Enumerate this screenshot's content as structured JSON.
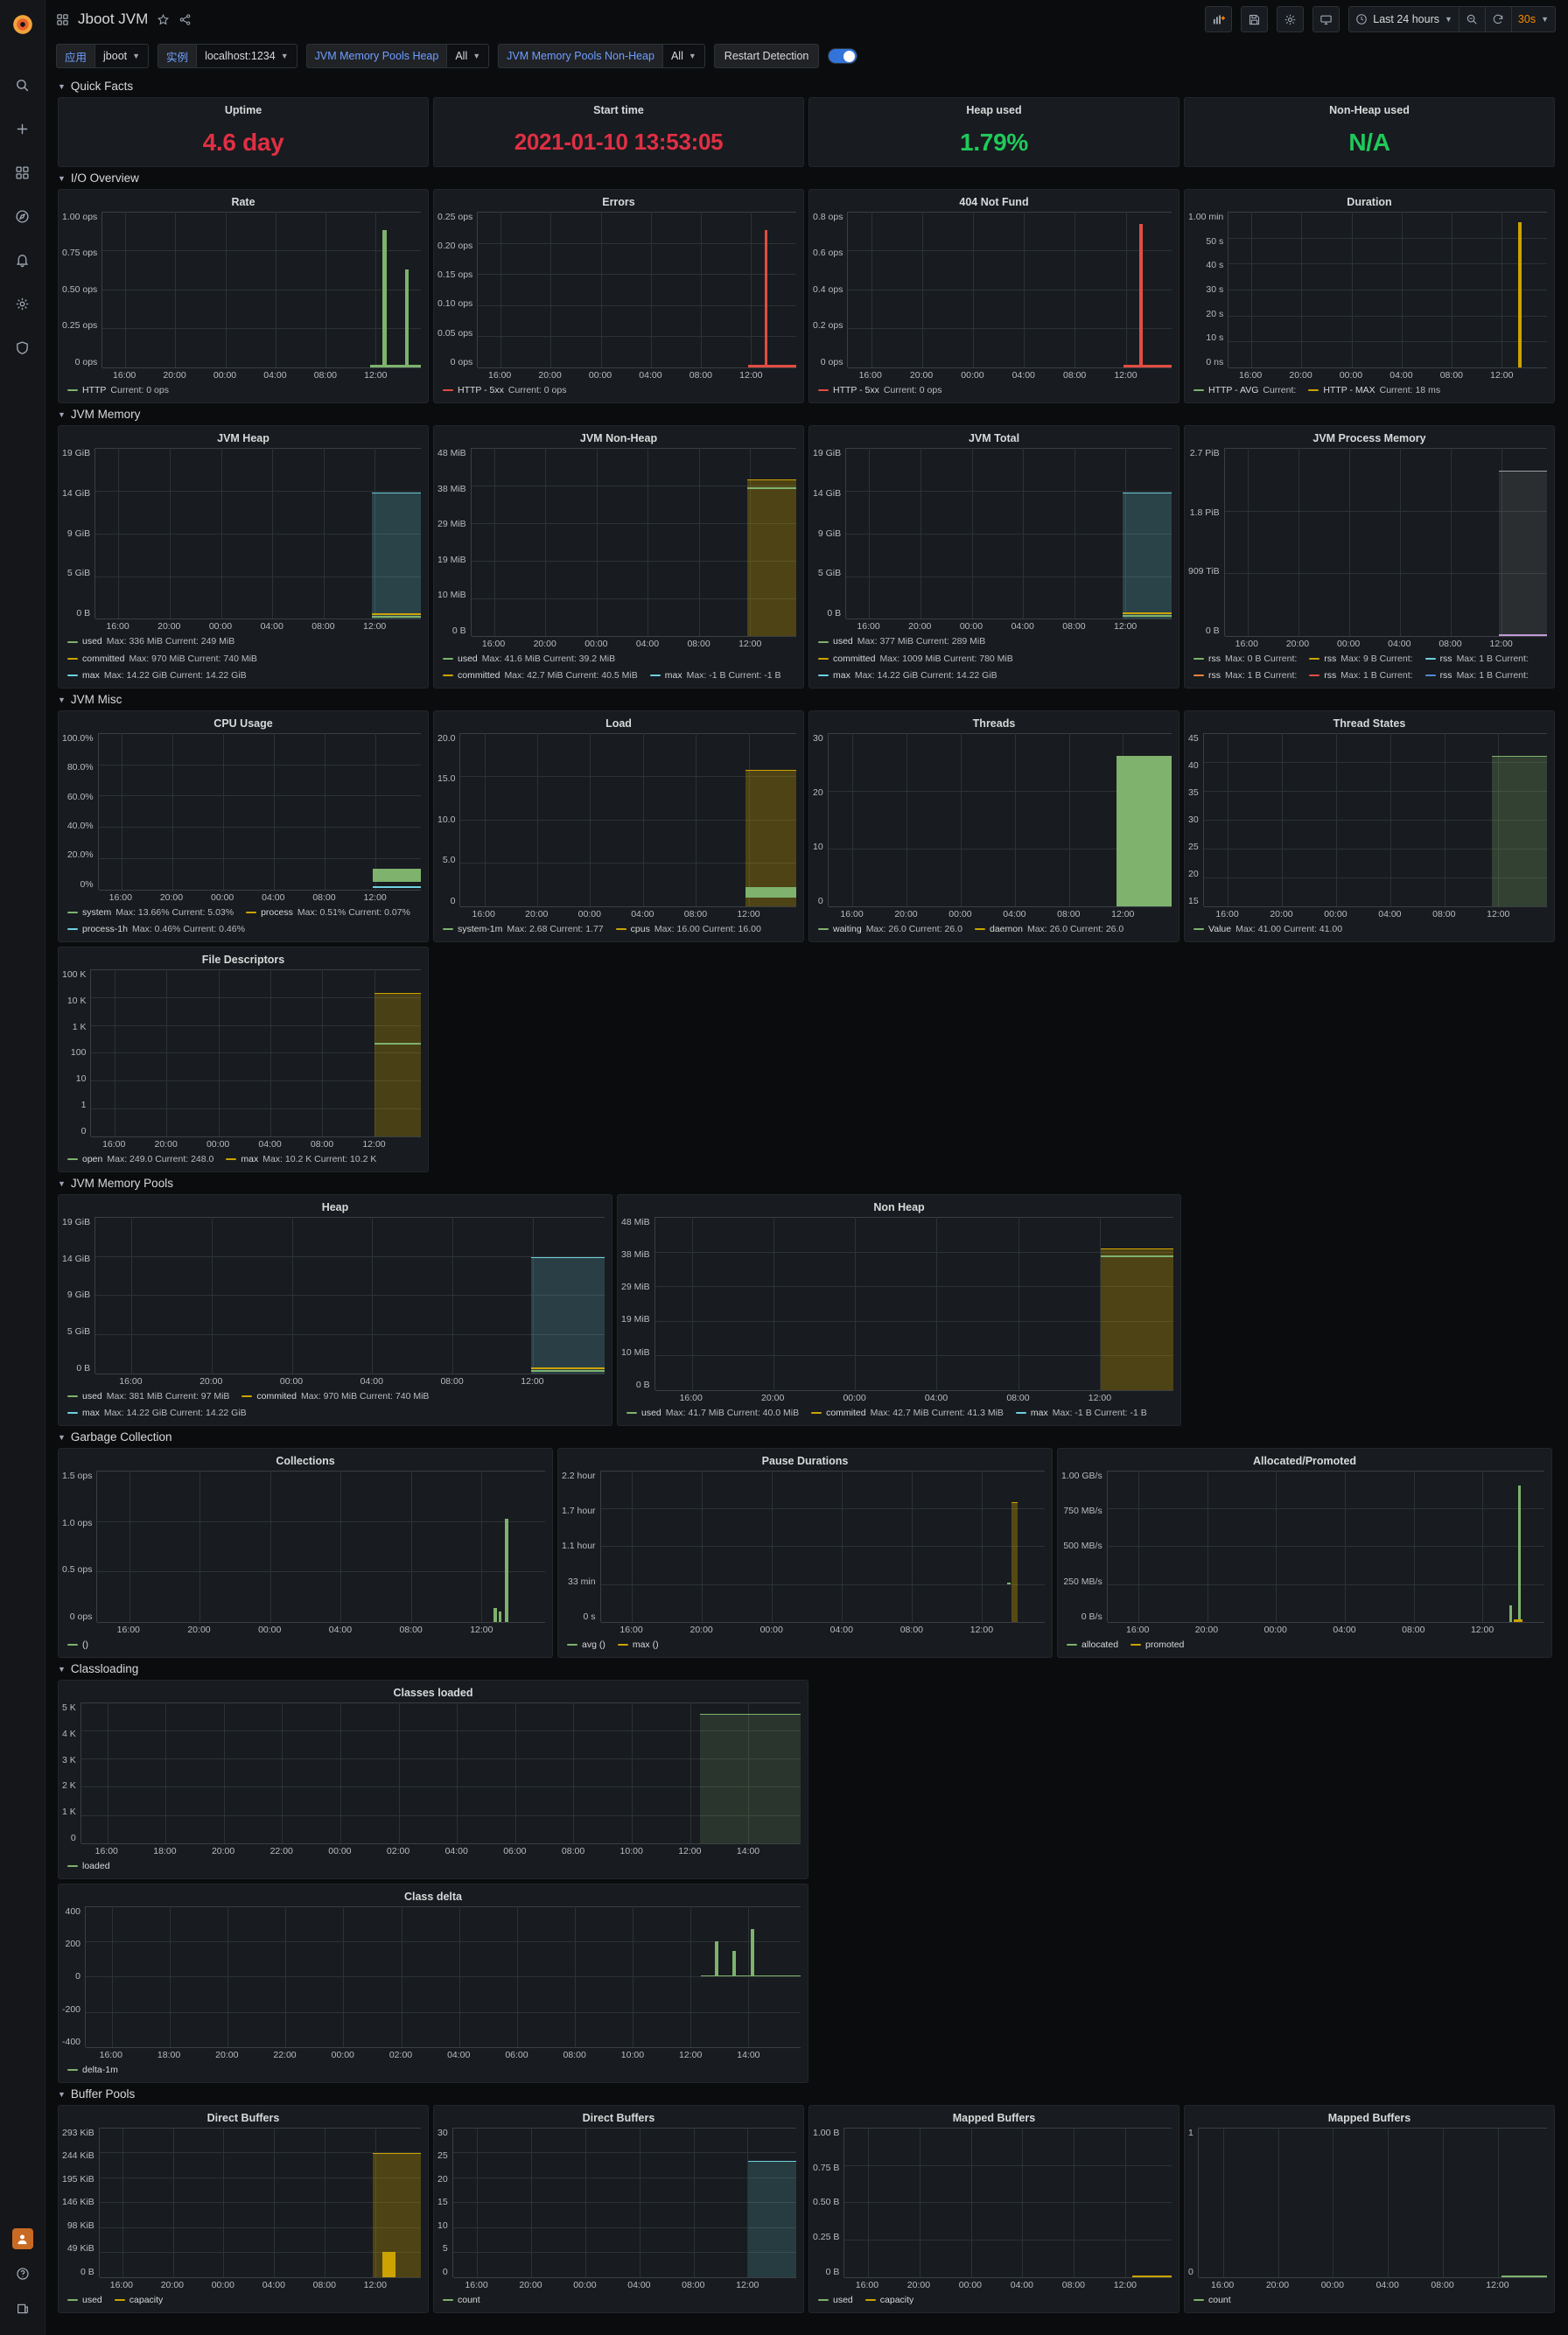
{
  "nav": {
    "logo": "grafana-logo",
    "items": [
      {
        "name": "search-icon"
      },
      {
        "name": "plus-icon"
      },
      {
        "name": "dashboards-icon"
      },
      {
        "name": "explore-icon"
      },
      {
        "name": "alerting-icon"
      },
      {
        "name": "configuration-icon"
      },
      {
        "name": "shield-icon"
      }
    ],
    "bottom": [
      {
        "name": "avatar"
      },
      {
        "name": "help-icon"
      },
      {
        "name": "news-icon"
      }
    ]
  },
  "header": {
    "dashboard_icon": "dashboard-grid-icon",
    "title": "Jboot JVM",
    "star_icon": "star-icon",
    "share_icon": "share-icon",
    "actions": {
      "add_panel": "add-panel-icon",
      "save": "save-icon",
      "settings": "gear-icon",
      "tv_mode": "tv-icon",
      "zoom_out": "zoom-out-icon",
      "refresh": "refresh-icon"
    },
    "time_range": "Last 24 hours",
    "refresh_interval": "30s"
  },
  "variables": [
    {
      "label": "应用",
      "value": "jboot",
      "has_caret": true
    },
    {
      "label": "实例",
      "value": "localhost:1234",
      "has_caret": true
    },
    {
      "label": "JVM Memory Pools Heap",
      "value": "All",
      "has_caret": true
    },
    {
      "label": "JVM Memory Pools Non-Heap",
      "value": "All",
      "has_caret": true
    }
  ],
  "restart_detection": {
    "label": "Restart Detection",
    "enabled": true
  },
  "colors": {
    "green": "#7eb26d",
    "yellow": "#cca300",
    "blue": "#6ed0e0",
    "red": "#e24d42",
    "orange": "#ef843c",
    "dark_blue": "#508bd1",
    "purple": "#bf9bd7",
    "stat_red": "#e02f44",
    "stat_green": "#1fca5b"
  },
  "sections": [
    {
      "id": "quick-facts",
      "title": "Quick Facts"
    },
    {
      "id": "io-overview",
      "title": "I/O Overview"
    },
    {
      "id": "jvm-memory",
      "title": "JVM Memory"
    },
    {
      "id": "jvm-misc",
      "title": "JVM Misc"
    },
    {
      "id": "jvm-memory-pools",
      "title": "JVM Memory Pools"
    },
    {
      "id": "garbage-collection",
      "title": "Garbage Collection"
    },
    {
      "id": "classloading",
      "title": "Classloading"
    },
    {
      "id": "buffer-pools",
      "title": "Buffer Pools"
    }
  ],
  "quick_facts": [
    {
      "title": "Uptime",
      "value": "4.6 day",
      "color": "#e02f44"
    },
    {
      "title": "Start time",
      "value": "2021-01-10 13:53:05",
      "color": "#e02f44"
    },
    {
      "title": "Heap used",
      "value": "1.79%",
      "color": "#1fca5b"
    },
    {
      "title": "Non-Heap used",
      "value": "N/A",
      "color": "#1fca5b"
    }
  ],
  "xticks_24h": [
    "16:00",
    "20:00",
    "00:00",
    "04:00",
    "08:00",
    "12:00"
  ],
  "xticks_2h": [
    "16:00",
    "18:00",
    "20:00",
    "22:00",
    "00:00",
    "02:00",
    "04:00",
    "06:00",
    "08:00",
    "10:00",
    "12:00",
    "14:00"
  ],
  "chart_data": [
    {
      "id": "rate",
      "type": "line",
      "title": "Rate",
      "yticks": [
        "1.00 ops",
        "0.75 ops",
        "0.50 ops",
        "0.25 ops",
        "0 ops"
      ],
      "ylim": [
        0,
        1.0
      ],
      "xticks": [
        "16:00",
        "20:00",
        "00:00",
        "04:00",
        "08:00",
        "12:00"
      ],
      "legend": [
        {
          "name": "HTTP",
          "color": "#7eb26d",
          "stats": "Current: 0 ops"
        }
      ]
    },
    {
      "id": "errors",
      "type": "line",
      "title": "Errors",
      "yticks": [
        "0.25 ops",
        "0.20 ops",
        "0.15 ops",
        "0.10 ops",
        "0.05 ops",
        "0 ops"
      ],
      "ylim": [
        0,
        0.25
      ],
      "xticks": [
        "16:00",
        "20:00",
        "00:00",
        "04:00",
        "08:00",
        "12:00"
      ],
      "legend": [
        {
          "name": "HTTP - 5xx",
          "color": "#e24d42",
          "stats": "Current: 0 ops"
        }
      ]
    },
    {
      "id": "not-found",
      "type": "line",
      "title": "404 Not Fund",
      "yticks": [
        "0.8 ops",
        "0.6 ops",
        "0.4 ops",
        "0.2 ops",
        "0 ops"
      ],
      "ylim": [
        0,
        0.8
      ],
      "xticks": [
        "16:00",
        "20:00",
        "00:00",
        "04:00",
        "08:00",
        "12:00"
      ],
      "legend": [
        {
          "name": "HTTP - 5xx",
          "color": "#e24d42",
          "stats": "Current: 0 ops"
        }
      ]
    },
    {
      "id": "duration",
      "type": "line",
      "title": "Duration",
      "yticks": [
        "1.00 min",
        "50 s",
        "40 s",
        "30 s",
        "20 s",
        "10 s",
        "0 ns"
      ],
      "ylim": [
        0,
        60
      ],
      "xticks": [
        "16:00",
        "20:00",
        "00:00",
        "04:00",
        "08:00",
        "12:00"
      ],
      "legend": [
        {
          "name": "HTTP - AVG",
          "color": "#7eb26d",
          "stats": "Current:"
        },
        {
          "name": "HTTP - MAX",
          "color": "#cca300",
          "stats": "Current: 18 ms"
        }
      ]
    },
    {
      "id": "jvm-heap",
      "type": "area",
      "title": "JVM Heap",
      "yticks": [
        "19 GiB",
        "14 GiB",
        "9 GiB",
        "5 GiB",
        "0 B"
      ],
      "ylim": [
        0,
        19
      ],
      "xticks": [
        "16:00",
        "20:00",
        "00:00",
        "04:00",
        "08:00",
        "12:00"
      ],
      "legend": [
        {
          "name": "used",
          "color": "#7eb26d",
          "stats": "Max: 336 MiB  Current: 249 MiB"
        },
        {
          "name": "committed",
          "color": "#cca300",
          "stats": "Max: 970 MiB  Current: 740 MiB"
        },
        {
          "name": "max",
          "color": "#6ed0e0",
          "stats": "Max: 14.22 GiB  Current: 14.22 GiB"
        }
      ]
    },
    {
      "id": "jvm-non-heap",
      "type": "area",
      "title": "JVM Non-Heap",
      "yticks": [
        "48 MiB",
        "38 MiB",
        "29 MiB",
        "19 MiB",
        "10 MiB",
        "0 B"
      ],
      "ylim": [
        0,
        48
      ],
      "xticks": [
        "16:00",
        "20:00",
        "00:00",
        "04:00",
        "08:00",
        "12:00"
      ],
      "legend": [
        {
          "name": "used",
          "color": "#7eb26d",
          "stats": "Max: 41.6 MiB  Current: 39.2 MiB"
        },
        {
          "name": "committed",
          "color": "#cca300",
          "stats": "Max: 42.7 MiB  Current: 40.5 MiB"
        },
        {
          "name": "max",
          "color": "#6ed0e0",
          "stats": "Max: -1 B  Current: -1 B"
        }
      ]
    },
    {
      "id": "jvm-total",
      "type": "area",
      "title": "JVM Total",
      "yticks": [
        "19 GiB",
        "14 GiB",
        "9 GiB",
        "5 GiB",
        "0 B"
      ],
      "ylim": [
        0,
        19
      ],
      "xticks": [
        "16:00",
        "20:00",
        "00:00",
        "04:00",
        "08:00",
        "12:00"
      ],
      "legend": [
        {
          "name": "used",
          "color": "#7eb26d",
          "stats": "Max: 377 MiB  Current: 289 MiB"
        },
        {
          "name": "committed",
          "color": "#cca300",
          "stats": "Max: 1009 MiB  Current: 780 MiB"
        },
        {
          "name": "max",
          "color": "#6ed0e0",
          "stats": "Max: 14.22 GiB  Current: 14.22 GiB"
        }
      ]
    },
    {
      "id": "jvm-process-memory",
      "type": "area",
      "title": "JVM Process Memory",
      "yticks": [
        "2.7 PiB",
        "1.8 PiB",
        "909 TiB",
        "0 B"
      ],
      "ylim": [
        0,
        2.7
      ],
      "xticks": [
        "16:00",
        "20:00",
        "00:00",
        "04:00",
        "08:00",
        "12:00"
      ],
      "legend": [
        {
          "name": "rss",
          "color": "#7eb26d",
          "stats": "Max: 0 B  Current:"
        },
        {
          "name": "rss",
          "color": "#cca300",
          "stats": "Max: 9 B  Current:"
        },
        {
          "name": "rss",
          "color": "#6ed0e0",
          "stats": "Max: 1 B  Current:"
        },
        {
          "name": "rss",
          "color": "#ef843c",
          "stats": "Max: 1 B  Current:"
        },
        {
          "name": "rss",
          "color": "#e24d42",
          "stats": "Max: 1 B  Current:"
        },
        {
          "name": "rss",
          "color": "#508bd1",
          "stats": "Max: 1 B  Current:"
        }
      ]
    },
    {
      "id": "cpu-usage",
      "type": "line",
      "title": "CPU Usage",
      "yticks": [
        "100.0%",
        "80.0%",
        "60.0%",
        "40.0%",
        "20.0%",
        "0%"
      ],
      "ylim": [
        0,
        100
      ],
      "xticks": [
        "16:00",
        "20:00",
        "00:00",
        "04:00",
        "08:00",
        "12:00"
      ],
      "legend": [
        {
          "name": "system",
          "color": "#7eb26d",
          "stats": "Max: 13.66%  Current: 5.03%"
        },
        {
          "name": "process",
          "color": "#cca300",
          "stats": "Max: 0.51%  Current: 0.07%"
        },
        {
          "name": "process-1h",
          "color": "#6ed0e0",
          "stats": "Max: 0.46%  Current: 0.46%"
        }
      ]
    },
    {
      "id": "load",
      "type": "area",
      "title": "Load",
      "yticks": [
        "20.0",
        "15.0",
        "10.0",
        "5.0",
        "0"
      ],
      "ylim": [
        0,
        20
      ],
      "xticks": [
        "16:00",
        "20:00",
        "00:00",
        "04:00",
        "08:00",
        "12:00"
      ],
      "legend": [
        {
          "name": "system-1m",
          "color": "#7eb26d",
          "stats": "Max: 2.68  Current: 1.77"
        },
        {
          "name": "cpus",
          "color": "#cca300",
          "stats": "Max: 16.00  Current: 16.00"
        }
      ]
    },
    {
      "id": "threads",
      "type": "area",
      "title": "Threads",
      "yticks": [
        "30",
        "20",
        "10",
        "0"
      ],
      "ylim": [
        0,
        30
      ],
      "xticks": [
        "16:00",
        "20:00",
        "00:00",
        "04:00",
        "08:00",
        "12:00"
      ],
      "legend": [
        {
          "name": "waiting",
          "color": "#7eb26d",
          "stats": "Max: 26.0  Current: 26.0"
        },
        {
          "name": "daemon",
          "color": "#cca300",
          "stats": "Max: 26.0  Current: 26.0"
        }
      ]
    },
    {
      "id": "thread-states",
      "type": "area",
      "title": "Thread States",
      "yticks": [
        "45",
        "40",
        "35",
        "30",
        "25",
        "20",
        "15"
      ],
      "ylim": [
        15,
        45
      ],
      "xticks": [
        "16:00",
        "20:00",
        "00:00",
        "04:00",
        "08:00",
        "12:00"
      ],
      "legend": [
        {
          "name": "Value",
          "color": "#7eb26d",
          "stats": "Max: 41.00  Current: 41.00"
        }
      ]
    },
    {
      "id": "file-descriptors",
      "type": "area",
      "title": "File Descriptors",
      "yticks": [
        "100 K",
        "10 K",
        "1 K",
        "100",
        "10",
        "1",
        "0"
      ],
      "ylim": [
        0,
        100000
      ],
      "xticks": [
        "16:00",
        "20:00",
        "00:00",
        "04:00",
        "08:00",
        "12:00"
      ],
      "legend": [
        {
          "name": "open",
          "color": "#7eb26d",
          "stats": "Max: 249.0  Current: 248.0"
        },
        {
          "name": "max",
          "color": "#cca300",
          "stats": "Max: 10.2 K  Current: 10.2 K"
        }
      ]
    },
    {
      "id": "pool-heap",
      "type": "area",
      "title": "Heap",
      "yticks": [
        "19 GiB",
        "14 GiB",
        "9 GiB",
        "5 GiB",
        "0 B"
      ],
      "ylim": [
        0,
        19
      ],
      "xticks": [
        "16:00",
        "20:00",
        "00:00",
        "04:00",
        "08:00",
        "12:00"
      ],
      "legend": [
        {
          "name": "used",
          "color": "#7eb26d",
          "stats": "Max: 381 MiB  Current: 97 MiB"
        },
        {
          "name": "commited",
          "color": "#cca300",
          "stats": "Max: 970 MiB  Current: 740 MiB"
        },
        {
          "name": "max",
          "color": "#6ed0e0",
          "stats": "Max: 14.22 GiB  Current: 14.22 GiB"
        }
      ]
    },
    {
      "id": "pool-non-heap",
      "type": "area",
      "title": "Non Heap",
      "yticks": [
        "48 MiB",
        "38 MiB",
        "29 MiB",
        "19 MiB",
        "10 MiB",
        "0 B"
      ],
      "ylim": [
        0,
        48
      ],
      "xticks": [
        "16:00",
        "20:00",
        "00:00",
        "04:00",
        "08:00",
        "12:00"
      ],
      "legend": [
        {
          "name": "used",
          "color": "#7eb26d",
          "stats": "Max: 41.7 MiB  Current: 40.0 MiB"
        },
        {
          "name": "commited",
          "color": "#cca300",
          "stats": "Max: 42.7 MiB  Current: 41.3 MiB"
        },
        {
          "name": "max",
          "color": "#6ed0e0",
          "stats": "Max: -1 B  Current: -1 B"
        }
      ]
    },
    {
      "id": "collections",
      "type": "line",
      "title": "Collections",
      "yticks": [
        "1.5 ops",
        "1.0 ops",
        "0.5 ops",
        "0 ops"
      ],
      "ylim": [
        0,
        1.5
      ],
      "xticks": [
        "16:00",
        "20:00",
        "00:00",
        "04:00",
        "08:00",
        "12:00"
      ],
      "legend": [
        {
          "name": "()",
          "color": "#7eb26d",
          "stats": ""
        }
      ]
    },
    {
      "id": "pause-durations",
      "type": "area",
      "title": "Pause Durations",
      "yticks": [
        "2.2 hour",
        "1.7 hour",
        "1.1 hour",
        "33 min",
        "0 s"
      ],
      "ylim": [
        0,
        2.2
      ],
      "xticks": [
        "16:00",
        "20:00",
        "00:00",
        "04:00",
        "08:00",
        "12:00"
      ],
      "legend": [
        {
          "name": "avg ()",
          "color": "#7eb26d",
          "stats": ""
        },
        {
          "name": "max ()",
          "color": "#cca300",
          "stats": ""
        }
      ]
    },
    {
      "id": "allocated-promoted",
      "type": "line",
      "title": "Allocated/Promoted",
      "yticks": [
        "1.00 GB/s",
        "750 MB/s",
        "500 MB/s",
        "250 MB/s",
        "0 B/s"
      ],
      "ylim": [
        0,
        1.0
      ],
      "xticks": [
        "16:00",
        "20:00",
        "00:00",
        "04:00",
        "08:00",
        "12:00"
      ],
      "legend": [
        {
          "name": "allocated",
          "color": "#7eb26d",
          "stats": ""
        },
        {
          "name": "promoted",
          "color": "#cca300",
          "stats": ""
        }
      ]
    },
    {
      "id": "classes-loaded",
      "type": "area",
      "title": "Classes loaded",
      "yticks": [
        "5 K",
        "4 K",
        "3 K",
        "2 K",
        "1 K",
        "0"
      ],
      "ylim": [
        0,
        5000
      ],
      "xticks": [
        "16:00",
        "18:00",
        "20:00",
        "22:00",
        "00:00",
        "02:00",
        "04:00",
        "06:00",
        "08:00",
        "10:00",
        "12:00",
        "14:00"
      ],
      "legend": [
        {
          "name": "loaded",
          "color": "#7eb26d",
          "stats": ""
        }
      ]
    },
    {
      "id": "class-delta",
      "type": "line",
      "title": "Class delta",
      "yticks": [
        "400",
        "200",
        "0",
        "-200",
        "-400"
      ],
      "ylim": [
        -400,
        400
      ],
      "xticks": [
        "16:00",
        "18:00",
        "20:00",
        "22:00",
        "00:00",
        "02:00",
        "04:00",
        "06:00",
        "08:00",
        "10:00",
        "12:00",
        "14:00"
      ],
      "legend": [
        {
          "name": "delta-1m",
          "color": "#7eb26d",
          "stats": ""
        }
      ]
    },
    {
      "id": "direct-buffers-size",
      "type": "area",
      "title": "Direct Buffers",
      "yticks": [
        "293 KiB",
        "244 KiB",
        "195 KiB",
        "146 KiB",
        "98 KiB",
        "49 KiB",
        "0 B"
      ],
      "ylim": [
        0,
        293
      ],
      "xticks": [
        "16:00",
        "20:00",
        "00:00",
        "04:00",
        "08:00",
        "12:00"
      ],
      "legend": [
        {
          "name": "used",
          "color": "#7eb26d",
          "stats": ""
        },
        {
          "name": "capacity",
          "color": "#cca300",
          "stats": ""
        }
      ]
    },
    {
      "id": "direct-buffers-count",
      "type": "line",
      "title": "Direct Buffers",
      "yticks": [
        "30",
        "25",
        "20",
        "15",
        "10",
        "5",
        "0"
      ],
      "ylim": [
        0,
        30
      ],
      "xticks": [
        "16:00",
        "20:00",
        "00:00",
        "04:00",
        "08:00",
        "12:00"
      ],
      "legend": [
        {
          "name": "count",
          "color": "#7eb26d",
          "stats": ""
        }
      ]
    },
    {
      "id": "mapped-buffers-size",
      "type": "line",
      "title": "Mapped Buffers",
      "yticks": [
        "1.00 B",
        "0.75 B",
        "0.50 B",
        "0.25 B",
        "0 B"
      ],
      "ylim": [
        0,
        1.0
      ],
      "xticks": [
        "16:00",
        "20:00",
        "00:00",
        "04:00",
        "08:00",
        "12:00"
      ],
      "legend": [
        {
          "name": "used",
          "color": "#7eb26d",
          "stats": ""
        },
        {
          "name": "capacity",
          "color": "#cca300",
          "stats": ""
        }
      ]
    },
    {
      "id": "mapped-buffers-count",
      "type": "line",
      "title": "Mapped Buffers",
      "yticks": [
        "1",
        "0"
      ],
      "ylim": [
        0,
        1
      ],
      "xticks": [
        "16:00",
        "20:00",
        "00:00",
        "04:00",
        "08:00",
        "12:00"
      ],
      "legend": [
        {
          "name": "count",
          "color": "#7eb26d",
          "stats": ""
        }
      ]
    }
  ]
}
